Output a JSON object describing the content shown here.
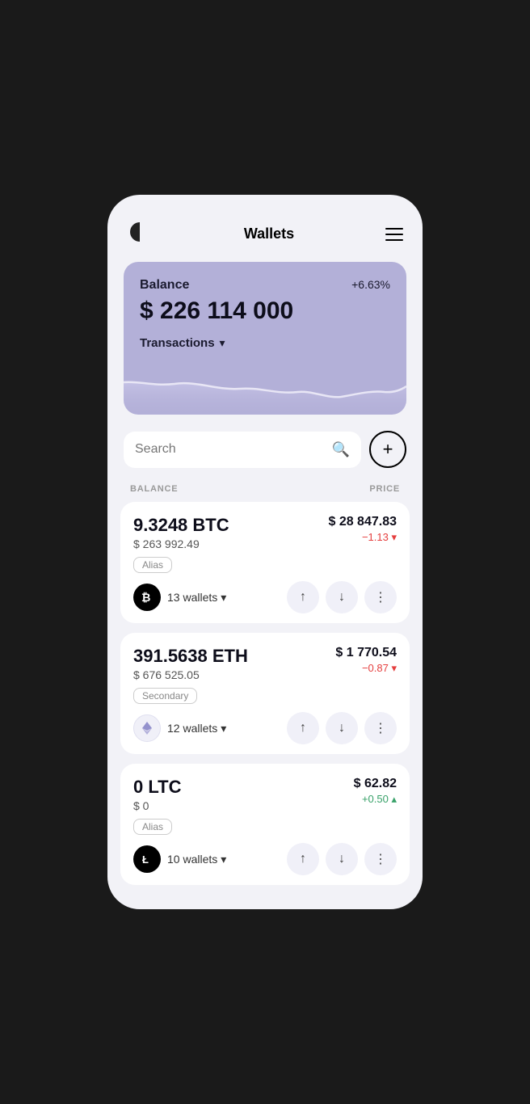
{
  "app": {
    "title": "Wallets"
  },
  "header": {
    "title": "Wallets",
    "logo_alt": "app-logo",
    "menu_alt": "menu"
  },
  "balance_card": {
    "label": "Balance",
    "amount": "$ 226 114 000",
    "change": "+6.63%",
    "transactions_label": "Transactions"
  },
  "search": {
    "placeholder": "Search"
  },
  "table_headers": {
    "balance": "BALANCE",
    "price": "PRICE"
  },
  "add_button_label": "+",
  "coins": [
    {
      "id": "btc",
      "amount": "9.3248 BTC",
      "usd": "$ 263 992.49",
      "alias": "Alias",
      "wallet_count": "13 wallets",
      "price": "$ 28 847.83",
      "change": "−1.13 ▾",
      "change_type": "negative",
      "logo_type": "btc"
    },
    {
      "id": "eth",
      "amount": "391.5638 ETH",
      "usd": "$ 676 525.05",
      "alias": "Secondary",
      "wallet_count": "12 wallets",
      "price": "$ 1 770.54",
      "change": "−0.87 ▾",
      "change_type": "negative",
      "logo_type": "eth"
    },
    {
      "id": "ltc",
      "amount": "0 LTC",
      "usd": "$ 0",
      "alias": "Alias",
      "wallet_count": "10 wallets",
      "price": "$ 62.82",
      "change": "+0.50 ▴",
      "change_type": "positive",
      "logo_type": "ltc"
    }
  ]
}
